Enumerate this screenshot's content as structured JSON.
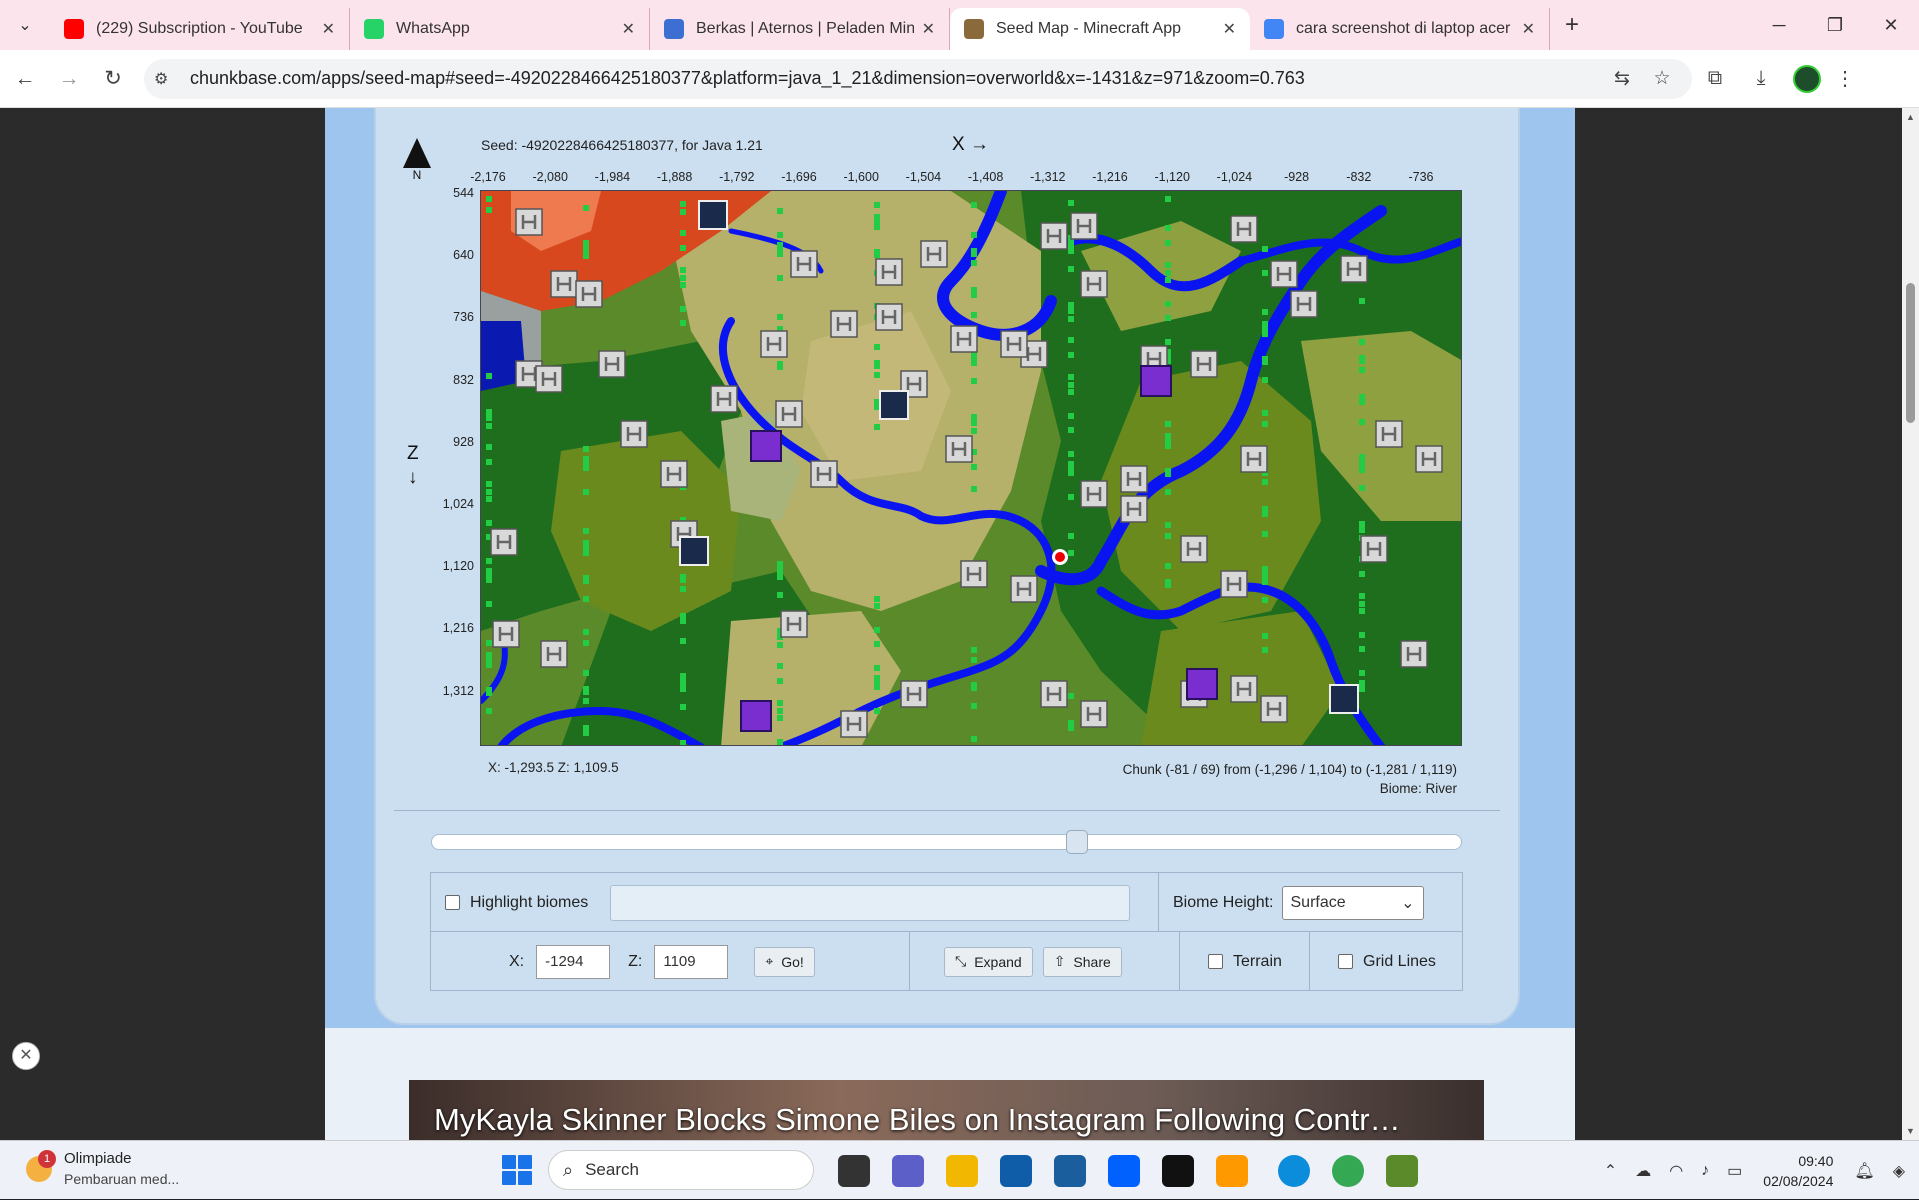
{
  "browser": {
    "tabs": [
      {
        "title": "(229) Subscription - YouTube",
        "icon": "youtube-icon",
        "color": "#ff0000",
        "active": false
      },
      {
        "title": "WhatsApp",
        "icon": "whatsapp-icon",
        "color": "#25d366",
        "active": false
      },
      {
        "title": "Berkas | Aternos | Peladen Mine",
        "icon": "aternos-icon",
        "color": "#3c6fd1",
        "active": false
      },
      {
        "title": "Seed Map - Minecraft App",
        "icon": "chunkbase-icon",
        "color": "#8a6a3a",
        "active": true
      },
      {
        "title": "cara screenshot di laptop acer -",
        "icon": "google-icon",
        "color": "#4285f4",
        "active": false
      }
    ],
    "url": "chunkbase.com/apps/seed-map#seed=-4920228466425180377&platform=java_1_21&dimension=overworld&x=-1431&z=971&zoom=0.763"
  },
  "seedmap": {
    "seed_text": "Seed: -4920228466425180377, for Java 1.21",
    "x_axis_label": "X →",
    "z_axis_label": "Z",
    "z_arrow": "↓",
    "north": "N",
    "x_ticks": [
      "-2,176",
      "-2,080",
      "-1,984",
      "-1,888",
      "-1,792",
      "-1,696",
      "-1,600",
      "-1,504",
      "-1,408",
      "-1,312",
      "-1,216",
      "-1,120",
      "-1,024",
      "-928",
      "-832",
      "-736"
    ],
    "z_ticks": [
      "544",
      "640",
      "736",
      "832",
      "928",
      "1,024",
      "1,120",
      "1,216",
      "1,312"
    ],
    "cursor_coords": "X: -1,293.5   Z: 1,109.5",
    "chunk_info": "Chunk (-81 / 69) from (-1,296 / 1,104) to (-1,281 / 1,119)",
    "biome_info": "Biome: River"
  },
  "controls": {
    "highlight_biomes": "Highlight biomes",
    "biome_height_label": "Biome Height:",
    "biome_height_value": "Surface",
    "x_label": "X:",
    "x_value": "-1294",
    "z_label": "Z:",
    "z_value": "1109",
    "go": "Go!",
    "expand": "Expand",
    "share": "Share",
    "terrain": "Terrain",
    "grid_lines": "Grid Lines"
  },
  "ad": {
    "headline": "MyKayla Skinner Blocks Simone Biles on Instagram Following Contr…"
  },
  "taskbar": {
    "notif_badge": "1",
    "notif_title": "Olimpiade",
    "notif_sub": "Pembaruan med...",
    "search": "Search",
    "time": "09:40",
    "date": "02/08/2024"
  }
}
